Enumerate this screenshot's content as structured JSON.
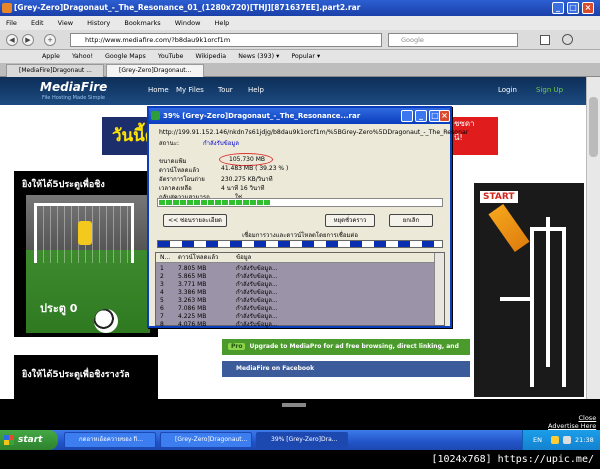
{
  "window": {
    "title": "[Grey-Zero]Dragonaut_-_The_Resonance_01_(1280x720)[THJ][871637EE].part2.rar",
    "btn_min": "_",
    "btn_max": "□",
    "btn_close": "×"
  },
  "menu": [
    "File",
    "Edit",
    "View",
    "History",
    "Bookmarks",
    "Window",
    "Help"
  ],
  "nav": {
    "back": "◀",
    "forward": "▶",
    "add": "+",
    "url": "http://www.mediafire.com/?b8dau9k1orcf1m",
    "search_placeholder": "Google"
  },
  "bookmarks": [
    "Apple",
    "Yahoo!",
    "Google Maps",
    "YouTube",
    "Wikipedia",
    "News (393) ▾",
    "Popular ▾"
  ],
  "tabs": [
    "[MediaFire]Dragonaut ...",
    "[Grey-Zero]Dragonaut..."
  ],
  "mediafire": {
    "logo": "MediaFire",
    "tagline": "File Hosting Made Simple",
    "nav": [
      "Home",
      "My Files",
      "Tour",
      "Help"
    ],
    "login": "Login",
    "signup": "Sign Up",
    "banner_left": "วันนี้ดู",
    "banner_right": "ชซดา\nนี!",
    "game_a_title": "ยิงให้ได้5ประตูเพื่อชิง",
    "game_a_score": "ประตู 0",
    "game_b_title": "ยิงให้ได้5ประตูเพื่อชิงรางวัล",
    "maze_start": "START",
    "upgrade_badge": "Pro",
    "upgrade_text": "Upgrade to MediaPro for ad free browsing, direct linking, and more.",
    "facebook": "MediaFire on Facebook"
  },
  "dialog": {
    "title": "39% [Grey-Zero]Dragonaut_-_The_Resonance...rar",
    "url": "http://199.91.152.146/nkdn7s61jdjg/b8dau9k1orcf1m/%5BGrey-Zero%5DDragonaut_-_The_Resonar",
    "status_label": "สถานะ:",
    "status_value": "กำลังรับข้อมูล",
    "size_label": "ขนาดแฟ้ม",
    "size_value": "105.730  MB",
    "downloaded_label": "ดาวน์โหลดแล้ว",
    "downloaded_value": "41.483  MB  ( 39.23 % )",
    "rate_label": "อัตราการโอนถ่าย",
    "rate_value": "230.275  KB/วินาที",
    "remaining_label": "เวลาคงเหลือ",
    "remaining_value": "4 นาที 16 วินาที",
    "resume_label": "กลับสู่ความสามารถ",
    "resume_value": "ใช่",
    "progress": 0.3923,
    "btn_details": "<< ซ่อนรายละเอียด",
    "btn_pause": "หยุดชั่วคราว",
    "btn_cancel": "ยกเลิก",
    "connections_label": "เชื่อมการวางและดาวน์โหลดโดยการเชื่อมต่อ",
    "col_num": "N...",
    "col_downloaded": "ดาวน์โหลดแล้ว",
    "col_info": "ข้อมูล",
    "rows": [
      {
        "n": "1",
        "size": "7.805  MB",
        "info": "กำลังรับข้อมูล..."
      },
      {
        "n": "2",
        "size": "5.865  MB",
        "info": "กำลังรับข้อมูล..."
      },
      {
        "n": "3",
        "size": "3.771  MB",
        "info": "กำลังรับข้อมูล..."
      },
      {
        "n": "4",
        "size": "3.386  MB",
        "info": "กำลังรับข้อมูล..."
      },
      {
        "n": "5",
        "size": "3.263  MB",
        "info": "กำลังรับข้อมูล..."
      },
      {
        "n": "6",
        "size": "7.086  MB",
        "info": "กำลังรับข้อมูล..."
      },
      {
        "n": "7",
        "size": "4.225  MB",
        "info": "กำลังรับข้อมูล..."
      },
      {
        "n": "8",
        "size": "4.076  MB",
        "info": "กำลังรับข้อมูล..."
      }
    ]
  },
  "ad_links": {
    "close": "Close",
    "advertise": "Advertise Here"
  },
  "taskbar": {
    "start": "start",
    "tasks": [
      "กดอาหเอ้อควายของ fi...",
      "[Grey-Zero]Dragonaut...",
      "39% [Grey-Zero]Dra..."
    ],
    "lang": "EN",
    "clock": "21:38"
  },
  "footer": "[1024x768] https://upic.me/"
}
